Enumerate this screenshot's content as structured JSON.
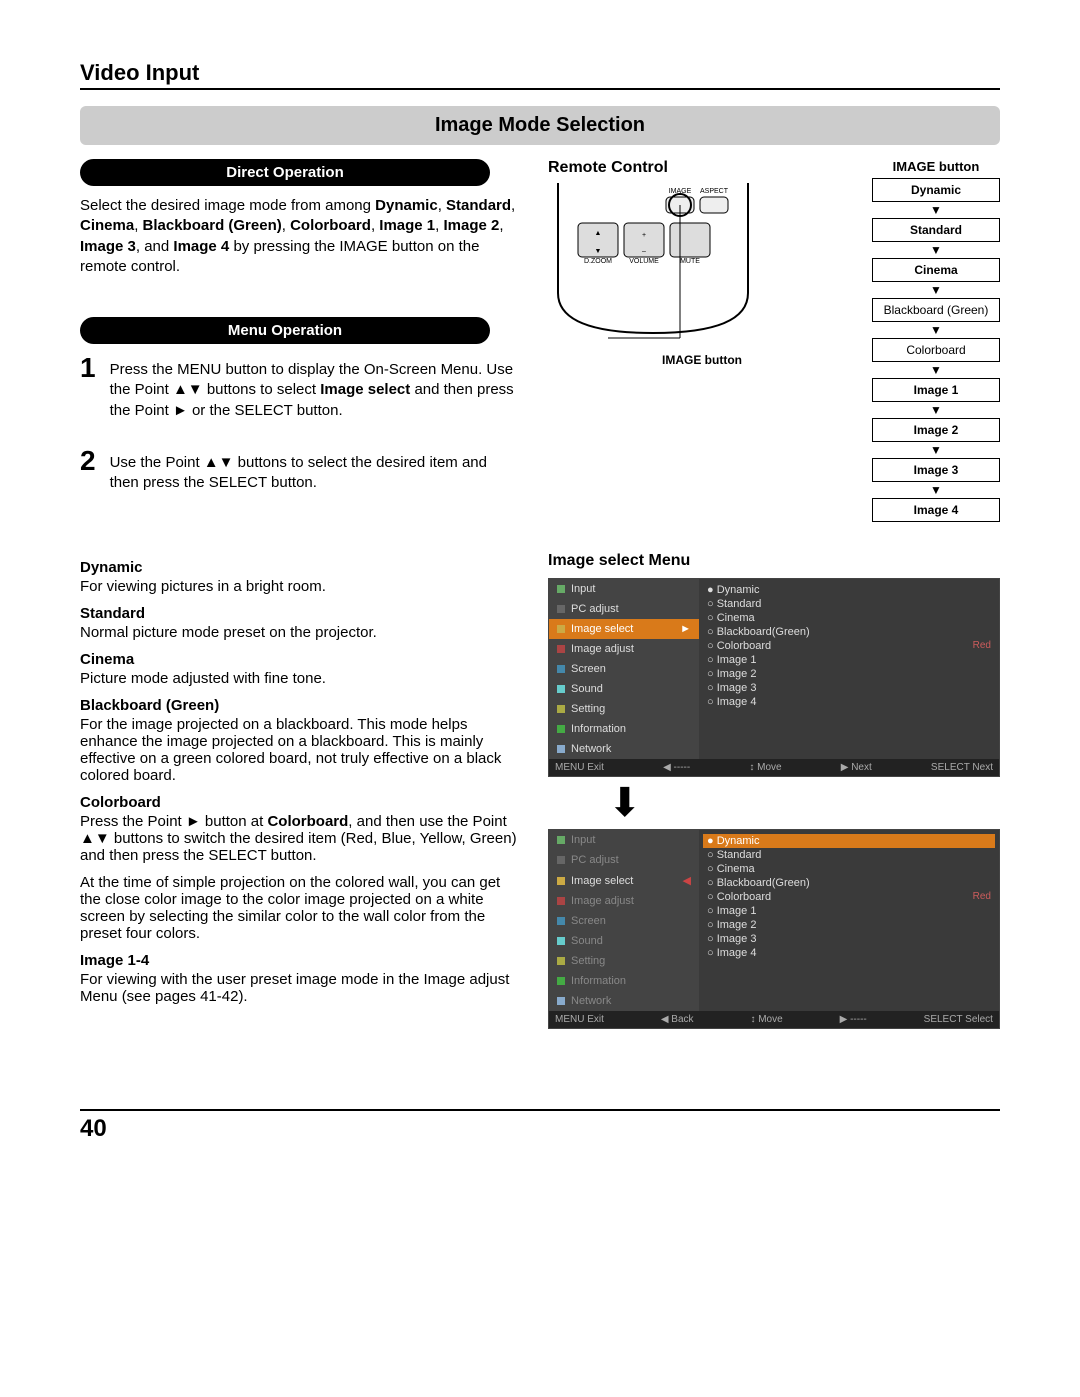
{
  "header": {
    "section": "Video Input",
    "title": "Image Mode Selection"
  },
  "pills": {
    "direct": "Direct Operation",
    "menu": "Menu Operation"
  },
  "directText": {
    "p1a": "Select the desired image mode from among ",
    "p1b": "Dynamic",
    "p1c": ", ",
    "p1d": "Standard",
    "p1e": ", ",
    "p1f": "Cinema",
    "p1g": ", ",
    "p1h": "Blackboard (Green)",
    "p1i": ", ",
    "p1j": "Colorboard",
    "p1k": ", ",
    "p1l": "Image 1",
    "p1m": ", ",
    "p1n": "Image 2",
    "p1o": ", ",
    "p1p": "Image 3",
    "p1q": ", and ",
    "p1r": "Image 4",
    "p1s": " by pressing the IMAGE button on the remote control."
  },
  "steps": {
    "s1": "Press the MENU button to display the On-Screen Menu. Use the Point ▲▼ buttons to select Image select and then press the Point ► or the SELECT button.",
    "s2": "Use the Point ▲▼ buttons to select the desired item and then press the SELECT button.",
    "s1bold": "Image select"
  },
  "modes": [
    {
      "t": "Dynamic",
      "d": "For viewing pictures in a bright room."
    },
    {
      "t": "Standard",
      "d": "Normal picture mode preset on the projector."
    },
    {
      "t": "Cinema",
      "d": "Picture mode adjusted with fine tone."
    },
    {
      "t": "Blackboard (Green)",
      "d": "For the image projected on a blackboard. This mode helps enhance the image projected on a blackboard. This is mainly effective on a green colored board, not truly effective on a black colored board."
    },
    {
      "t": "Colorboard",
      "d": "Press the Point ► button at Colorboard, and then use the Point ▲▼ buttons to switch the desired item (Red, Blue, Yellow, Green) and then press the SELECT button."
    },
    {
      "t": "",
      "d": "At the time of simple projection on the colored wall, you can get the close color image to the color image projected on a white screen by selecting the similar color to the wall color from the preset four colors."
    },
    {
      "t": "Image 1-4",
      "d": "For viewing with the user preset image mode in the Image adjust Menu (see pages 41-42)."
    }
  ],
  "right": {
    "remoteLabel": "Remote Control",
    "imageBtnLabel": "IMAGE button",
    "flowTitle": "IMAGE button",
    "flow": [
      "Dynamic",
      "Standard",
      "Cinema",
      "Blackboard (Green)",
      "Colorboard",
      "Image 1",
      "Image 2",
      "Image 3",
      "Image 4"
    ],
    "menuTitle": "Image select Menu",
    "osdLeft": [
      "Input",
      "PC adjust",
      "Image select",
      "Image adjust",
      "Screen",
      "Sound",
      "Setting",
      "Information",
      "Network"
    ],
    "osdRight": [
      "Dynamic",
      "Standard",
      "Cinema",
      "Blackboard(Green)",
      "Colorboard",
      "Image 1",
      "Image 2",
      "Image 3",
      "Image 4"
    ],
    "redLabel": "Red",
    "foot1": {
      "exit": "MENU Exit",
      "back": "◀ -----",
      "move": "↕ Move",
      "next": "▶ Next",
      "sel": "SELECT Next"
    },
    "foot2": {
      "exit": "MENU Exit",
      "back": "◀ Back",
      "move": "↕ Move",
      "next": "▶ -----",
      "sel": "SELECT Select"
    }
  },
  "remoteBtns": {
    "image": "IMAGE",
    "aspect": "ASPECT",
    "dzoom": "D.ZOOM",
    "volume": "VOLUME",
    "mute": "MUTE"
  },
  "page": "40"
}
